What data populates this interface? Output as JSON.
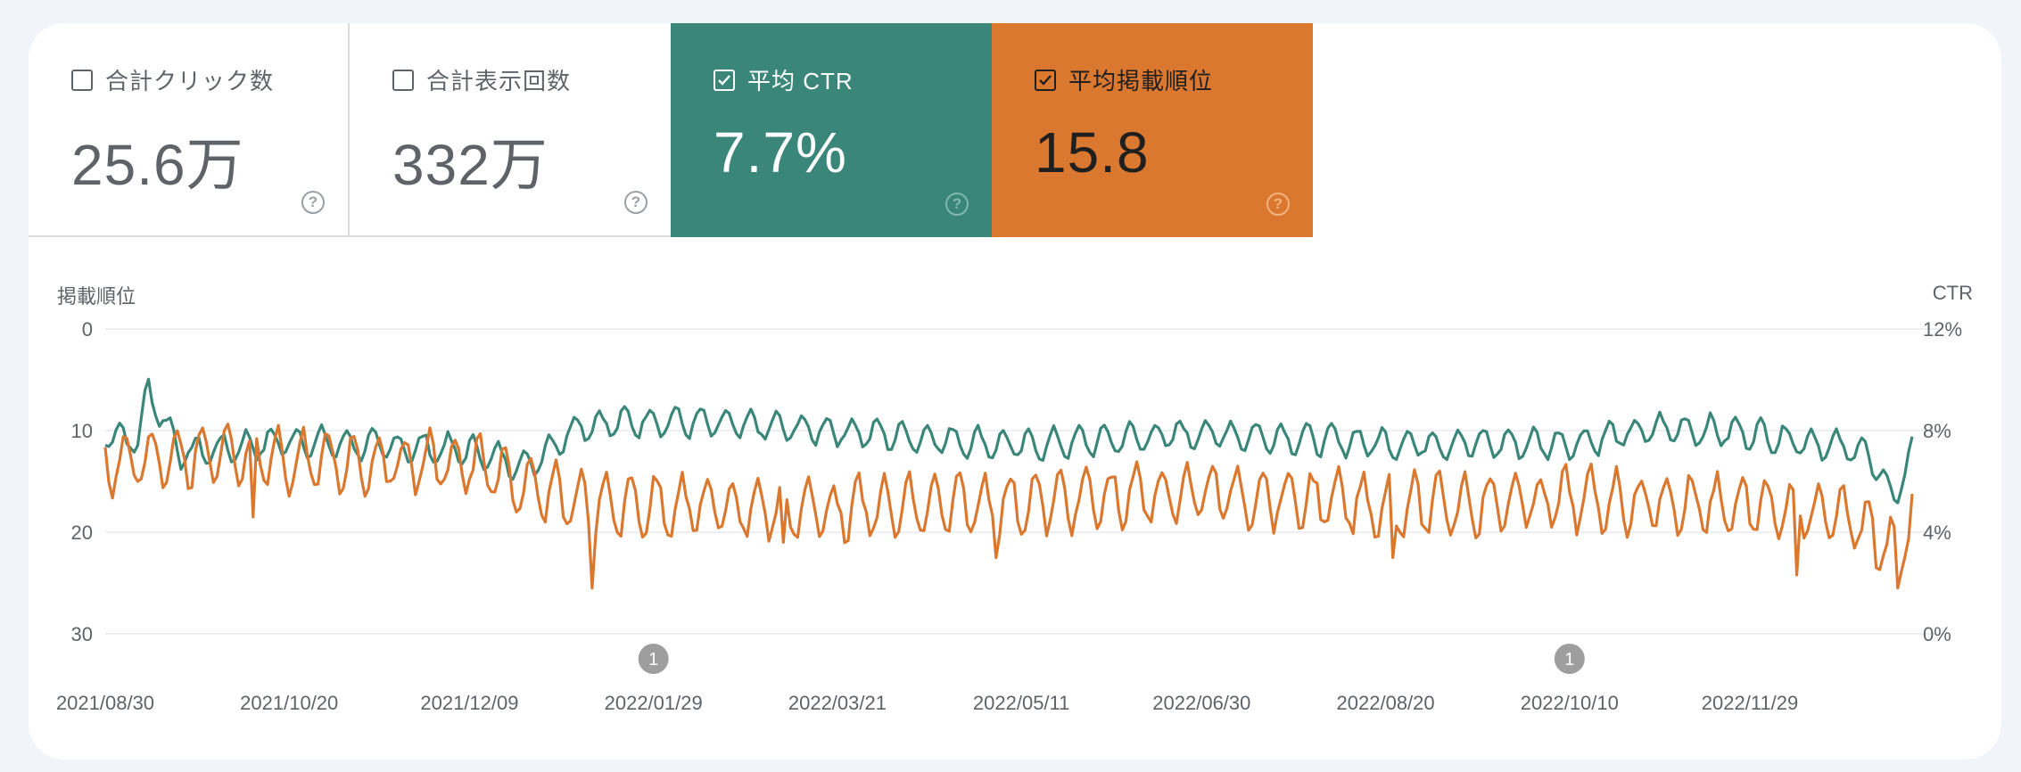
{
  "cards": [
    {
      "label": "合計クリック数",
      "value": "25.6万",
      "checked": false,
      "bg": "#ffffff",
      "fg": "#5f6368",
      "value_color": "#5f6368",
      "help_color": "#9aa0a6"
    },
    {
      "label": "合計表示回数",
      "value": "332万",
      "checked": false,
      "bg": "#ffffff",
      "fg": "#5f6368",
      "value_color": "#5f6368",
      "help_color": "#9aa0a6"
    },
    {
      "label": "平均 CTR",
      "value": "7.7%",
      "checked": true,
      "bg": "#3a877a",
      "fg": "#ffffff",
      "value_color": "#ffffff",
      "help_color": "#7fb9ae"
    },
    {
      "label": "平均掲載順位",
      "value": "15.8",
      "checked": true,
      "bg": "#db782f",
      "fg": "#1f1f1f",
      "value_color": "#1f1f1f",
      "help_color": "#f2b47e"
    }
  ],
  "help_glyph": "?",
  "chart_data": {
    "type": "line",
    "left_axis_title": "掲載順位",
    "right_axis_title": "CTR",
    "left_ticks": [
      "0",
      "10",
      "20",
      "30"
    ],
    "right_ticks": [
      "12%",
      "8%",
      "4%",
      "0%"
    ],
    "left_range": [
      0,
      30
    ],
    "left_inverted": true,
    "right_range": [
      0,
      12
    ],
    "x_tick_labels": [
      "2021/08/30",
      "2021/10/20",
      "2021/12/09",
      "2022/01/29",
      "2022/03/21",
      "2022/05/11",
      "2022/06/30",
      "2022/08/20",
      "2022/10/10",
      "2022/11/29"
    ],
    "x_range": [
      "2021/08/30",
      "2023/01/13"
    ],
    "annotations": [
      {
        "date": "2022/01/29",
        "label": "1"
      },
      {
        "date": "2022/10/10",
        "label": "1"
      }
    ],
    "series": [
      {
        "name": "平均 CTR",
        "axis": "right",
        "color": "#3a877a",
        "baseline": 7.4,
        "amplitude": 0.55,
        "keypoints": [
          {
            "date": "2021/08/30",
            "value": 7.9
          },
          {
            "date": "2021/09/08",
            "value": 7.6
          },
          {
            "date": "2021/09/11",
            "value": 9.6
          },
          {
            "date": "2021/09/20",
            "value": 7.1
          },
          {
            "date": "2021/10/20",
            "value": 7.6
          },
          {
            "date": "2021/12/09",
            "value": 7.2
          },
          {
            "date": "2021/12/25",
            "value": 6.6
          },
          {
            "date": "2022/01/08",
            "value": 8.2
          },
          {
            "date": "2022/01/29",
            "value": 8.4
          },
          {
            "date": "2022/03/21",
            "value": 8.0
          },
          {
            "date": "2022/05/11",
            "value": 7.4
          },
          {
            "date": "2022/06/30",
            "value": 7.9
          },
          {
            "date": "2022/08/20",
            "value": 7.5
          },
          {
            "date": "2022/10/10",
            "value": 7.5
          },
          {
            "date": "2022/11/05",
            "value": 8.1
          },
          {
            "date": "2022/11/29",
            "value": 7.9
          },
          {
            "date": "2022/12/31",
            "value": 7.2
          },
          {
            "date": "2023/01/08",
            "value": 5.3
          },
          {
            "date": "2023/01/13",
            "value": 7.3
          }
        ]
      },
      {
        "name": "平均掲載順位",
        "axis": "left",
        "color": "#db782f",
        "baseline": 15.8,
        "amplitude": 2.8,
        "keypoints": [
          {
            "date": "2021/08/30",
            "value": 13.3
          },
          {
            "date": "2021/09/15",
            "value": 12.4
          },
          {
            "date": "2021/10/20",
            "value": 13.0
          },
          {
            "date": "2021/12/09",
            "value": 13.2
          },
          {
            "date": "2021/12/27",
            "value": 16.0
          },
          {
            "date": "2022/01/15",
            "value": 17.5
          },
          {
            "date": "2022/01/29",
            "value": 17.3
          },
          {
            "date": "2022/03/21",
            "value": 17.8
          },
          {
            "date": "2022/05/11",
            "value": 17.2
          },
          {
            "date": "2022/06/30",
            "value": 16.0
          },
          {
            "date": "2022/08/20",
            "value": 17.5
          },
          {
            "date": "2022/10/10",
            "value": 16.8
          },
          {
            "date": "2022/11/29",
            "value": 17.4
          },
          {
            "date": "2022/12/31",
            "value": 19.0
          },
          {
            "date": "2023/01/10",
            "value": 22.0
          },
          {
            "date": "2023/01/13",
            "value": 16.0
          }
        ],
        "spikes": [
          {
            "date": "2021/10/10",
            "value": 18.5
          },
          {
            "date": "2021/12/30",
            "value": 19.0
          },
          {
            "date": "2022/01/12",
            "value": 25.5
          },
          {
            "date": "2022/03/06",
            "value": 21.0
          },
          {
            "date": "2022/05/04",
            "value": 22.5
          },
          {
            "date": "2022/08/22",
            "value": 22.5
          },
          {
            "date": "2022/12/12",
            "value": 24.2
          },
          {
            "date": "2023/01/03",
            "value": 23.5
          },
          {
            "date": "2023/01/09",
            "value": 25.5
          }
        ]
      }
    ],
    "grid": true,
    "gridline_color": "#e8eaed"
  }
}
